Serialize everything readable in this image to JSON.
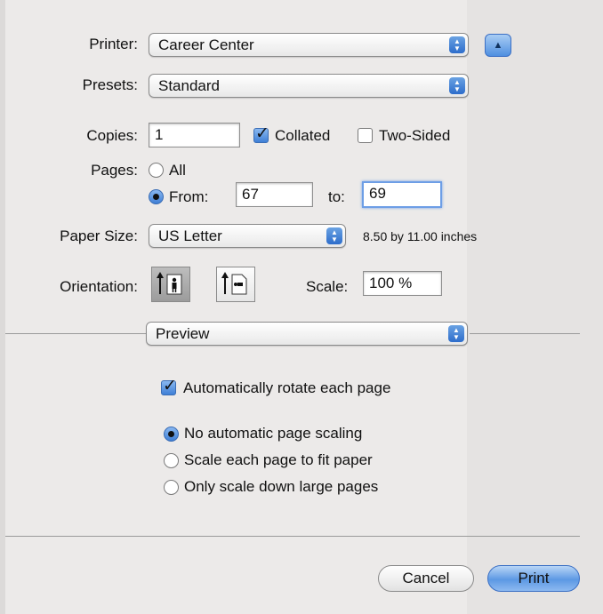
{
  "printer": {
    "label": "Printer:",
    "value": "Career Center"
  },
  "presets": {
    "label": "Presets:",
    "value": "Standard"
  },
  "copies": {
    "label": "Copies:",
    "value": "1",
    "collated_label": "Collated",
    "two_sided_label": "Two-Sided"
  },
  "pages": {
    "label": "Pages:",
    "all_label": "All",
    "from_label": "From:",
    "from_value": "67",
    "to_label": "to:",
    "to_value": "69"
  },
  "paper": {
    "label": "Paper Size:",
    "value": "US Letter",
    "dimensions": "8.50 by 11.00 inches"
  },
  "orientation": {
    "label": "Orientation:"
  },
  "scale": {
    "label": "Scale:",
    "value": "100 %"
  },
  "section": {
    "value": "Preview"
  },
  "options": {
    "auto_rotate_label": "Automatically rotate each page",
    "no_scaling_label": "No automatic page scaling",
    "scale_fit_label": "Scale each page to fit paper",
    "scale_down_label": "Only scale down large pages"
  },
  "buttons": {
    "cancel": "Cancel",
    "print": "Print"
  },
  "colors": {
    "accent": "#3f7fd6",
    "background": "#eceae9"
  }
}
